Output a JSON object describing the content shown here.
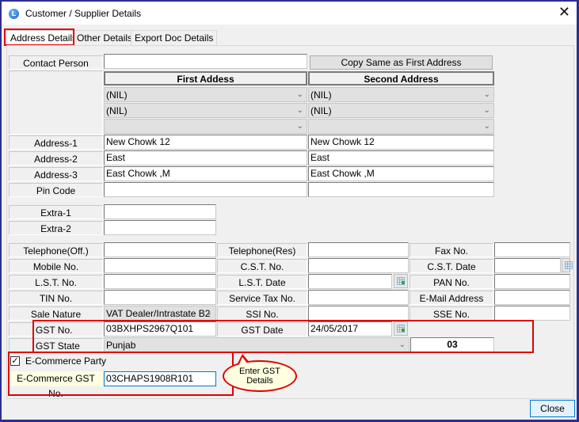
{
  "window": {
    "title": "Customer / Supplier Details",
    "app_icon": "L",
    "close_glyph": "✕"
  },
  "tabs": [
    {
      "label": "Address Details",
      "active": true
    },
    {
      "label": "Other Details",
      "active": false
    },
    {
      "label": "Export Doc Details",
      "active": false
    }
  ],
  "contact": {
    "label": "Contact Person",
    "value": "",
    "copy_button": "Copy Same as First Address"
  },
  "address_headers": {
    "first": "First Addess",
    "second": "Second Address"
  },
  "dropdowns": {
    "first": [
      "(NIL)",
      "(NIL)",
      ""
    ],
    "second": [
      "(NIL)",
      "(NIL)",
      ""
    ]
  },
  "address_rows": [
    {
      "label": "Address-1",
      "first": "New Chowk 12",
      "second": "New Chowk 12"
    },
    {
      "label": "Address-2",
      "first": "East",
      "second": "East"
    },
    {
      "label": "Address-3",
      "first": "East Chowk ,M",
      "second": "East Chowk ,M"
    },
    {
      "label": "Pin Code",
      "first": "",
      "second": ""
    }
  ],
  "extras": [
    {
      "label": "Extra-1",
      "value": ""
    },
    {
      "label": "Extra-2",
      "value": ""
    }
  ],
  "grid": {
    "col1": [
      {
        "label": "Telephone(Off.)",
        "value": ""
      },
      {
        "label": "Mobile No.",
        "value": ""
      },
      {
        "label": "L.S.T. No.",
        "value": ""
      },
      {
        "label": "TIN No.",
        "value": ""
      },
      {
        "label": "Sale Nature",
        "value": "VAT Dealer/Intrastate B2"
      }
    ],
    "col2": [
      {
        "label": "Telephone(Res)",
        "value": ""
      },
      {
        "label": "C.S.T. No.",
        "value": ""
      },
      {
        "label": "L.S.T. Date",
        "value": ""
      },
      {
        "label": "Service Tax No.",
        "value": ""
      },
      {
        "label": "SSI No.",
        "value": ""
      }
    ],
    "col3": [
      {
        "label": "Fax No.",
        "value": ""
      },
      {
        "label": "C.S.T. Date",
        "value": ""
      },
      {
        "label": "PAN No.",
        "value": ""
      },
      {
        "label": "E-Mail Address",
        "value": ""
      },
      {
        "label": "SSE No.",
        "value": ""
      }
    ]
  },
  "gst": {
    "no_label": "GST No.",
    "no_value": "03BXHPS2967Q101",
    "date_label": "GST Date",
    "date_value": "24/05/2017",
    "state_label": "GST State",
    "state_value": "Punjab",
    "state_code": "03"
  },
  "ecommerce": {
    "checkbox_label": "E-Commerce Party",
    "checked": true,
    "check_glyph": "✓",
    "gst_label": "E-Commerce GST No.",
    "gst_value": "03CHAPS1908R101"
  },
  "callout": {
    "line1": "Enter GST",
    "line2": "Details"
  },
  "footer": {
    "close_label": "Close"
  },
  "colors": {
    "highlight_red": "#e00000",
    "callout_fill": "#ffffe1",
    "frame_blue": "#2b2f8f",
    "focus_blue": "#0078d7"
  }
}
